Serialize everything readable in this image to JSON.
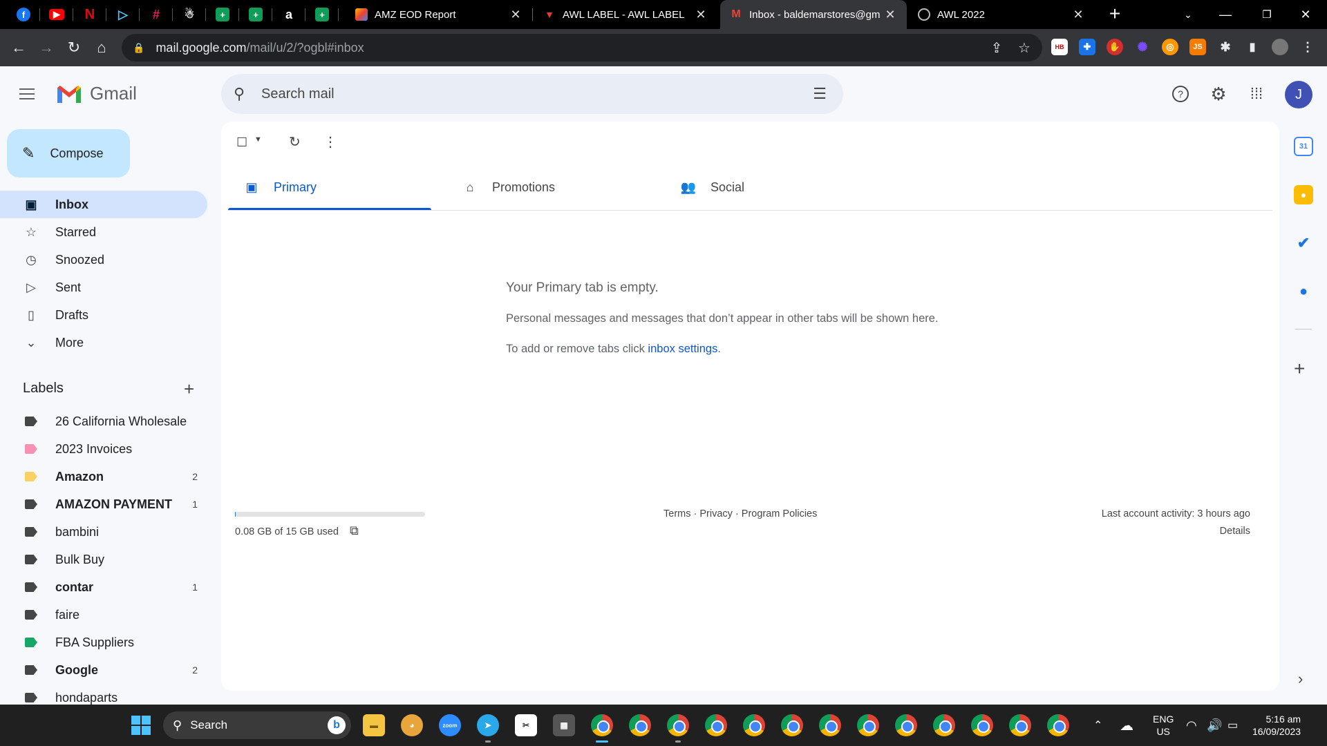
{
  "browser": {
    "tabs": [
      {
        "title": "AMZ EOD Report",
        "active": false
      },
      {
        "title": "AWL LABEL - AWL LABEL",
        "active": false
      },
      {
        "title": "Inbox - baldemarstores@gm",
        "active": true
      },
      {
        "title": "AWL 2022",
        "active": false
      }
    ],
    "url_domain": "mail.google.com",
    "url_path": "/mail/u/2/?ogbl#inbox"
  },
  "gmail": {
    "app_name": "Gmail",
    "search_placeholder": "Search mail",
    "account_initial": "J",
    "compose_label": "Compose",
    "nav": [
      {
        "label": "Inbox",
        "icon": "inbox-icon"
      },
      {
        "label": "Starred",
        "icon": "star-icon"
      },
      {
        "label": "Snoozed",
        "icon": "clock-icon"
      },
      {
        "label": "Sent",
        "icon": "send-icon"
      },
      {
        "label": "Drafts",
        "icon": "draft-icon"
      },
      {
        "label": "More",
        "icon": "chevron-down-icon"
      }
    ],
    "labels_heading": "Labels",
    "labels": [
      {
        "name": "26 California Wholesale",
        "count": "",
        "color": "#444746",
        "bold": false
      },
      {
        "name": "2023 Invoices",
        "count": "",
        "color": "#f691b2",
        "bold": false
      },
      {
        "name": "Amazon",
        "count": "2",
        "color": "#fad165",
        "bold": true
      },
      {
        "name": "AMAZON PAYMENT",
        "count": "1",
        "color": "#444746",
        "bold": true
      },
      {
        "name": "bambini",
        "count": "",
        "color": "#444746",
        "bold": false
      },
      {
        "name": "Bulk Buy",
        "count": "",
        "color": "#444746",
        "bold": false
      },
      {
        "name": "contar",
        "count": "1",
        "color": "#444746",
        "bold": true
      },
      {
        "name": "faire",
        "count": "",
        "color": "#444746",
        "bold": false
      },
      {
        "name": "FBA Suppliers",
        "count": "",
        "color": "#16a766",
        "bold": false
      },
      {
        "name": "Google",
        "count": "2",
        "color": "#444746",
        "bold": true
      },
      {
        "name": "hondaparts",
        "count": "",
        "color": "#444746",
        "bold": false
      }
    ],
    "category_tabs": [
      {
        "label": "Primary",
        "icon": "inbox-icon"
      },
      {
        "label": "Promotions",
        "icon": "tag-icon"
      },
      {
        "label": "Social",
        "icon": "people-icon"
      }
    ],
    "empty": {
      "title": "Your Primary tab is empty.",
      "description": "Personal messages and messages that don’t appear in other tabs will be shown here.",
      "settings_prefix": "To add or remove tabs click ",
      "settings_link": "inbox settings",
      "settings_suffix": "."
    },
    "footer": {
      "storage": "0.08 GB of 15 GB used",
      "storage_fraction": 0.0053,
      "links": "Terms · Privacy · Program Policies",
      "last_activity": "Last account activity: 3 hours ago",
      "details": "Details"
    }
  },
  "taskbar": {
    "search_label": "Search",
    "language_line1": "ENG",
    "language_line2": "US",
    "time": "5:16 am",
    "date": "16/09/2023"
  },
  "colors": {
    "accent": "#0b57d0",
    "selected_nav": "#d3e3fd",
    "compose": "#c2e7ff"
  }
}
